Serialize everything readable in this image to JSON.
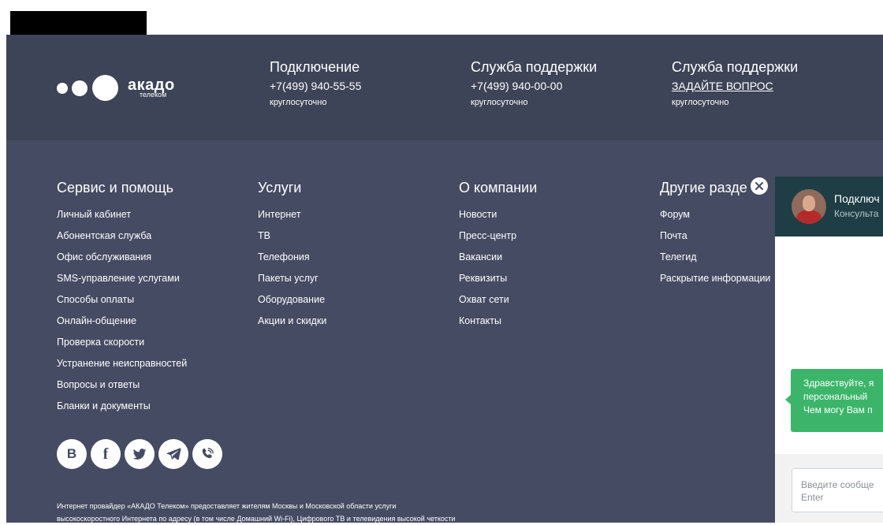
{
  "logo": {
    "brand": "акадо",
    "sub": "телеком"
  },
  "contacts": [
    {
      "title": "Подключение",
      "value": "+7(499) 940-55-55",
      "note": "круглосуточно"
    },
    {
      "title": "Служба поддержки",
      "value": "+7(499) 940-00-00",
      "note": "круглосуточно"
    },
    {
      "title": "Служба поддержки",
      "value": "ЗАДАЙТЕ ВОПРОС",
      "note": "круглосуточно"
    }
  ],
  "columns": [
    {
      "heading": "Сервис и помощь",
      "links": [
        "Личный кабинет",
        "Абонентская служба",
        "Офис обслуживания",
        "SMS-управление услугами",
        "Способы оплаты",
        "Онлайн-общение",
        "Проверка скорости",
        "Устранение неисправностей",
        "Вопросы и ответы",
        "Бланки и документы"
      ]
    },
    {
      "heading": "Услуги",
      "links": [
        "Интернет",
        "ТВ",
        "Телефония",
        "Пакеты услуг",
        "Оборудование",
        "Акции и скидки"
      ]
    },
    {
      "heading": "О компании",
      "links": [
        "Новости",
        "Пресс-центр",
        "Вакансии",
        "Реквизиты",
        "Охват сети",
        "Контакты"
      ]
    },
    {
      "heading": "Другие разде",
      "links": [
        "Форум",
        "Почта",
        "Телегид",
        "Раскрытие информации"
      ]
    }
  ],
  "social": [
    {
      "icon": "vk-icon",
      "glyph": "B"
    },
    {
      "icon": "facebook-icon",
      "glyph": "f"
    },
    {
      "icon": "twitter-icon"
    },
    {
      "icon": "telegram-icon"
    },
    {
      "icon": "viber-icon"
    }
  ],
  "legal": [
    "Интернет провайдер «АКАДО Телеком» предоставляет жителям Москвы и Московской области услуги",
    "высокоскоростного Интернета по адресу (в том числе Домашний Wi-Fi), Цифрового ТВ и телевидения высокой четкости"
  ],
  "chat": {
    "name": "Подключ",
    "role": "Консульта",
    "greeting": [
      "Здравствуйте, я",
      "персональный",
      "Чем могу Вам п"
    ],
    "input_placeholder": [
      "Введите сообще",
      "Enter"
    ]
  },
  "colors": {
    "footer_top": "#3e4457",
    "footer_main": "#454b62",
    "chat_header": "#1f3d44",
    "chat_bubble": "#3cb56a"
  }
}
